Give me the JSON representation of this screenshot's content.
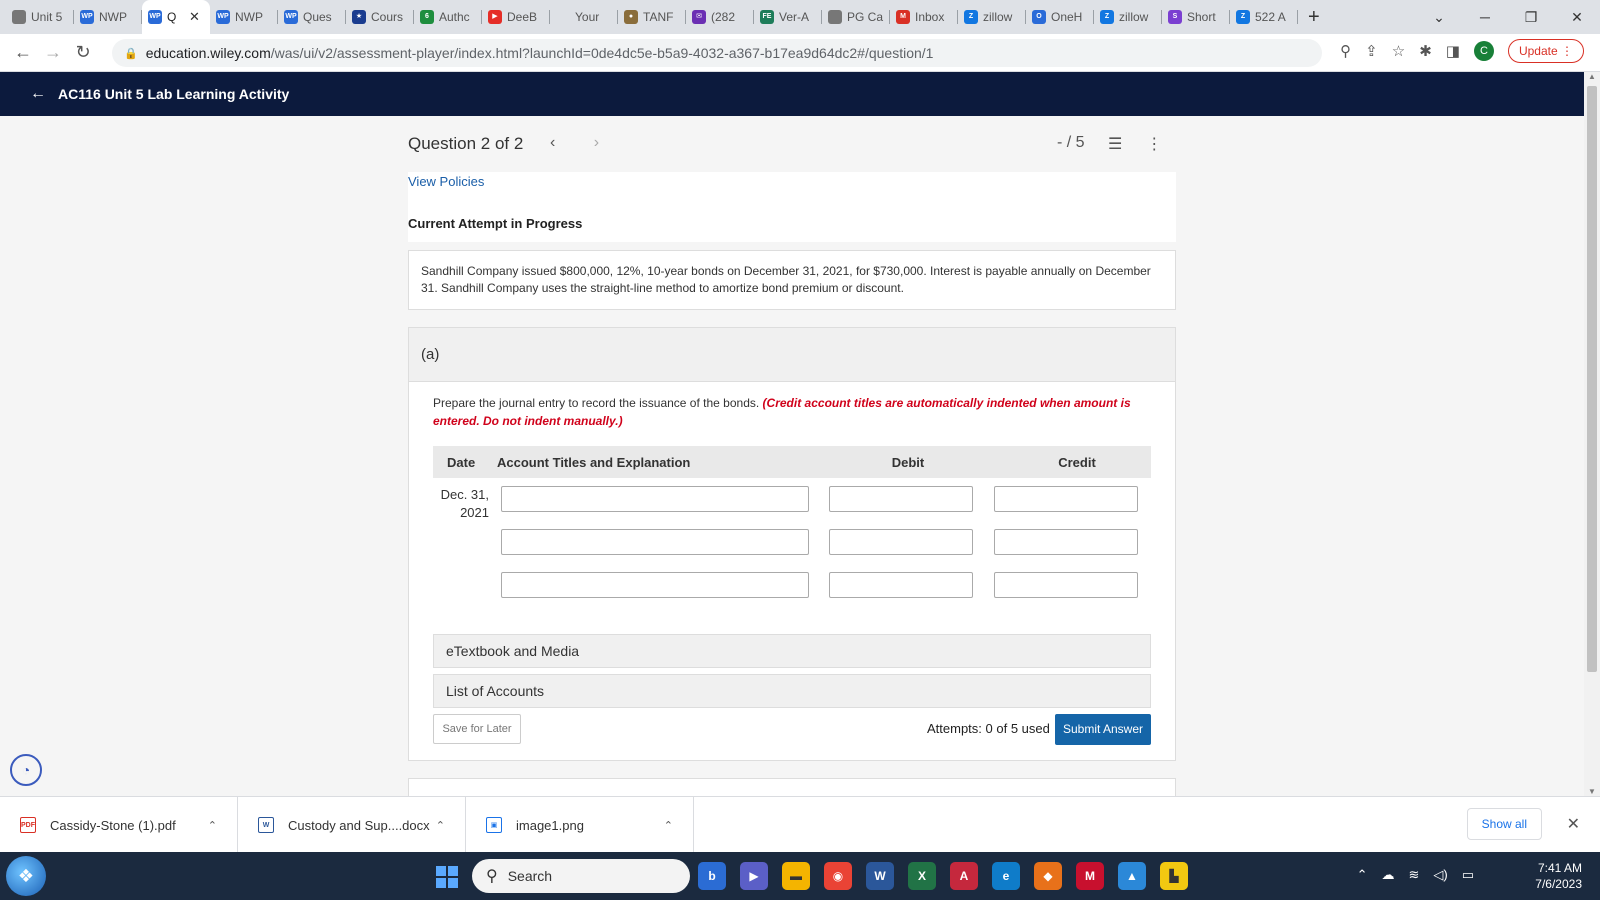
{
  "browser": {
    "tabs": [
      {
        "label": "Unit 5",
        "icon": "globe-icon",
        "color": "#777777",
        "glyph": ""
      },
      {
        "label": "NWP",
        "icon": "wp-icon",
        "color": "#2a6bd8",
        "glyph": "WP"
      },
      {
        "label": "Q",
        "icon": "wp-icon",
        "color": "#2a6bd8",
        "glyph": "WP",
        "active": true
      },
      {
        "label": "NWP",
        "icon": "wp-icon",
        "color": "#2a6bd8",
        "glyph": "WP"
      },
      {
        "label": "Ques",
        "icon": "wp-icon",
        "color": "#2a6bd8",
        "glyph": "WP"
      },
      {
        "label": "Cours",
        "icon": "star-icon",
        "color": "#1a3c8f",
        "glyph": "★"
      },
      {
        "label": "Authc",
        "icon": "auth-icon",
        "color": "#1e8e3e",
        "glyph": "6"
      },
      {
        "label": "DeeB",
        "icon": "youtube-icon",
        "color": "#e52d27",
        "glyph": "▶"
      },
      {
        "label": "Your",
        "icon": "blank-icon",
        "color": "#dee1e6",
        "glyph": ""
      },
      {
        "label": "TANF",
        "icon": "seal-icon",
        "color": "#8a6d3b",
        "glyph": "●"
      },
      {
        "label": "(282",
        "icon": "mail-icon",
        "color": "#6b2fb3",
        "glyph": "✉"
      },
      {
        "label": "Ver-A",
        "icon": "fe-icon",
        "color": "#1e7d5a",
        "glyph": "FE"
      },
      {
        "label": "PG Ca",
        "icon": "globe-icon",
        "color": "#777777",
        "glyph": ""
      },
      {
        "label": "Inbox",
        "icon": "gmail-icon",
        "color": "#d93025",
        "glyph": "M"
      },
      {
        "label": "zillow",
        "icon": "zillow-icon",
        "color": "#1277e1",
        "glyph": "Z"
      },
      {
        "label": "OneH",
        "icon": "onehome-icon",
        "color": "#2a6bd8",
        "glyph": "O"
      },
      {
        "label": "zillow",
        "icon": "zillow-icon",
        "color": "#1277e1",
        "glyph": "Z"
      },
      {
        "label": "Short",
        "icon": "short-icon",
        "color": "#7b3fd1",
        "glyph": "S"
      },
      {
        "label": "522 A",
        "icon": "zillow-icon",
        "color": "#1277e1",
        "glyph": "Z"
      }
    ],
    "url_domain": "education.wiley.com",
    "url_path": "/was/ui/v2/assessment-player/index.html?launchId=0de4dc5e-b5a9-4032-a367-b17ea9d64dc2#/question/1",
    "avatar": "C",
    "update_label": "Update"
  },
  "header": {
    "title": "AC116 Unit 5 Lab Learning Activity"
  },
  "question": {
    "title": "Question 2 of 2",
    "score": "- / 5",
    "view_policies": "View Policies",
    "attempt_status": "Current Attempt in Progress",
    "problem_text": "Sandhill Company issued $800,000, 12%, 10-year bonds on December 31, 2021, for $730,000. Interest is payable annually on December 31. Sandhill Company uses the straight-line method to amortize bond premium or discount."
  },
  "part": {
    "label": "(a)",
    "instruction": "Prepare the journal entry to record the issuance of the bonds.",
    "instruction_note": "(Credit account titles are automatically indented when amount is entered. Do not indent manually.)",
    "columns": {
      "date": "Date",
      "account": "Account Titles and Explanation",
      "debit": "Debit",
      "credit": "Credit"
    },
    "date_line1": "Dec. 31,",
    "date_line2": "2021",
    "rows": [
      {
        "account": "",
        "debit": "",
        "credit": ""
      },
      {
        "account": "",
        "debit": "",
        "credit": ""
      },
      {
        "account": "",
        "debit": "",
        "credit": ""
      }
    ],
    "etextbook": "eTextbook and Media",
    "list_of_accounts": "List of Accounts",
    "save_label": "Save for Later",
    "attempts": "Attempts: 0 of 5 used",
    "submit_label": "Submit Answer"
  },
  "downloads": {
    "items": [
      {
        "name": "Cassidy-Stone (1).pdf",
        "icon": "pdf-icon",
        "glyph": "PDF",
        "color": "#d93025"
      },
      {
        "name": "Custody and Sup....docx",
        "icon": "docx-icon",
        "glyph": "W",
        "color": "#2b579a"
      },
      {
        "name": "image1.png",
        "icon": "image-file-icon",
        "glyph": "▣",
        "color": "#1a73e8"
      }
    ],
    "show_all": "Show all"
  },
  "taskbar": {
    "search_label": "Search",
    "time": "7:41 AM",
    "date": "7/6/2023"
  }
}
